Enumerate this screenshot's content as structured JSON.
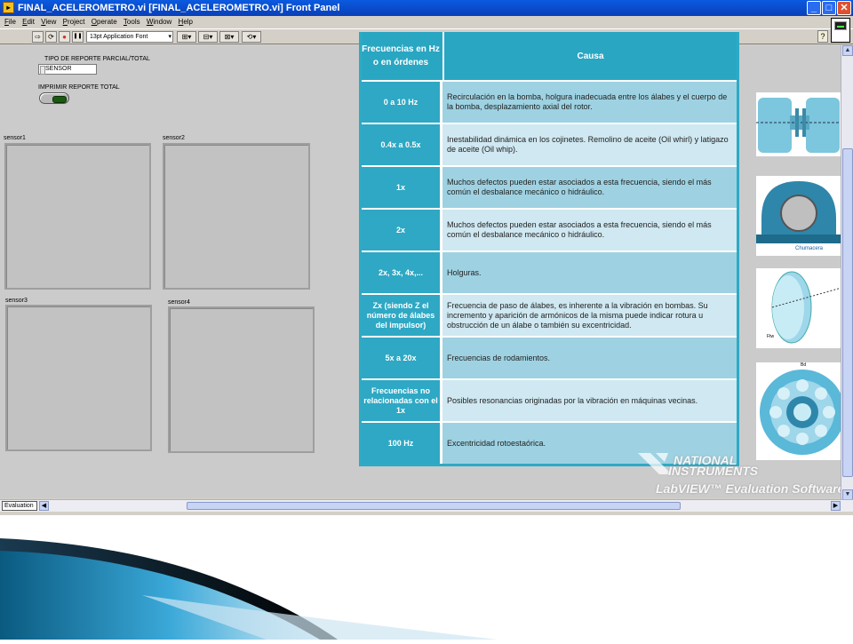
{
  "window": {
    "title": "FINAL_ACELEROMETRO.vi [FINAL_ACELEROMETRO.vi] Front Panel",
    "icon_label": "▸",
    "minimize": "_",
    "maximize": "□",
    "close": "✕"
  },
  "menu": [
    "File",
    "Edit",
    "View",
    "Project",
    "Operate",
    "Tools",
    "Window",
    "Help"
  ],
  "toolbar": {
    "run": "⇨",
    "run_continuous": "⟳",
    "abort": "●",
    "pause": "❚❚",
    "font": "13pt Application Font",
    "font_dropdown": "▾",
    "align": "⊞▾",
    "distribute": "⊟▾",
    "resize": "⊠▾",
    "reorder": "⟲▾",
    "help": "?"
  },
  "controls": {
    "report_type_label": "TIPO DE REPORTE PARCIAL/TOTAL",
    "report_type_value": "SENSOR",
    "print_label": "IMPRIMIR REPORTE TOTAL"
  },
  "charts": [
    {
      "label": "sensor1"
    },
    {
      "label": "sensor2"
    },
    {
      "label": "sensor3"
    },
    {
      "label": "sensor4"
    }
  ],
  "table": {
    "header_freq": "Frecuencias en Hz o en órdenes",
    "header_cause": "Causa",
    "rows": [
      {
        "freq": "0 a 10 Hz",
        "cause": "Recirculación en la bomba, holgura inadecuada entre los álabes y el cuerpo de la bomba, desplazamiento axial del rotor."
      },
      {
        "freq": "0.4x a 0.5x",
        "cause": "Inestabilidad dinámica en los cojinetes. Remolino de aceite (Oil whirl) y latigazo de aceite (Oil whip)."
      },
      {
        "freq": "1x",
        "cause": "Muchos defectos pueden estar asociados a esta frecuencia, siendo el más común el desbalance mecánico o hidráulico."
      },
      {
        "freq": "2x",
        "cause": "Muchos defectos pueden estar asociados a esta frecuencia, siendo el más común el desbalance mecánico o hidráulico."
      },
      {
        "freq": "2x, 3x, 4x,...",
        "cause": "Holguras."
      },
      {
        "freq": "Zx (siendo Z el número de álabes del impulsor)",
        "cause": "Frecuencia de paso de álabes, es inherente a la vibración en bombas. Su incremento y aparición de armónicos de la misma puede indicar rotura u obstrucción de un álabe o también su excentricidad."
      },
      {
        "freq": "5x a 20x",
        "cause": "Frecuencias de rodamientos."
      },
      {
        "freq": "Frecuencias no relacionadas con el 1x",
        "cause": "Posibles resonancias originadas por la vibración en máquinas vecinas."
      },
      {
        "freq": "100 Hz",
        "cause": "Excentricidad rotoestaórica."
      }
    ]
  },
  "images": {
    "chumacera_caption": "Chumacera",
    "disk_label": "Ftw",
    "bearing_label": "Bd"
  },
  "watermark": {
    "line1": "NATIONAL",
    "line2": "INSTRUMENTS",
    "line3": "LabVIEW™ Evaluation Software"
  },
  "scroll": {
    "up": "▲",
    "down": "▼",
    "left": "◀",
    "right": "▶"
  },
  "status": {
    "tab": "Evaluation"
  },
  "colors": {
    "header_teal": "#29a6c2",
    "row_dark": "#9ed2e2",
    "row_light": "#cfe8f1"
  }
}
